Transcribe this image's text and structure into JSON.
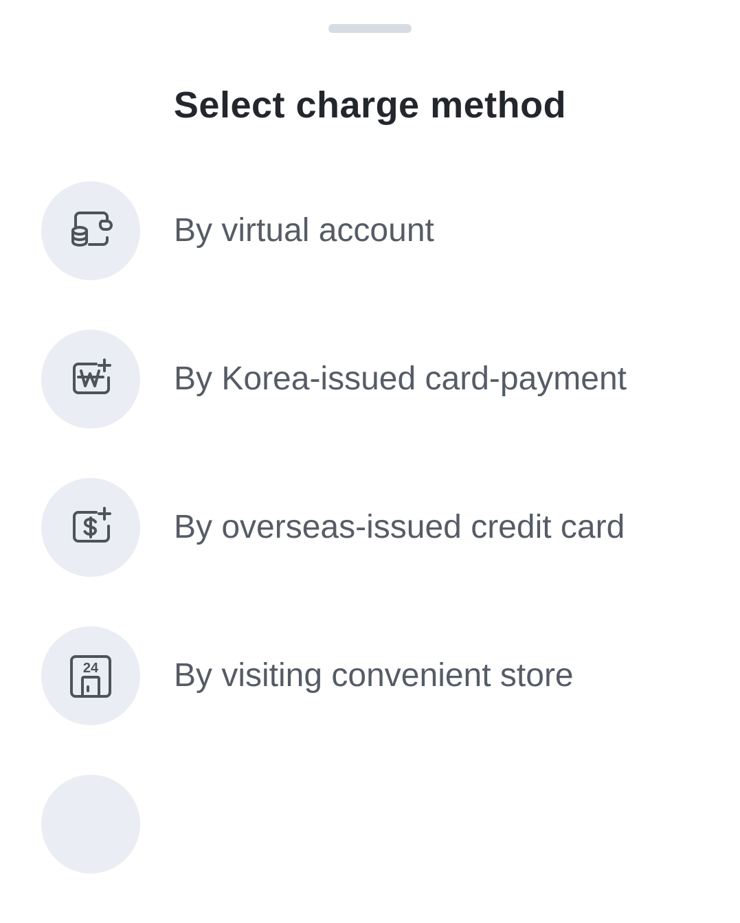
{
  "sheet": {
    "title": "Select charge method"
  },
  "options": [
    {
      "label": "By virtual account",
      "icon": "wallet-coins-icon"
    },
    {
      "label": "By Korea-issued card-payment",
      "icon": "won-card-plus-icon"
    },
    {
      "label": "By overseas-issued credit card",
      "icon": "dollar-card-plus-icon"
    },
    {
      "label": "By visiting convenient store",
      "icon": "store-24-icon",
      "icon_text": "24"
    },
    {
      "label": "",
      "icon": "partial-option-icon"
    }
  ],
  "colors": {
    "title": "#23272d",
    "label": "#555c66",
    "icon_bg": "#eaedf3",
    "icon_stroke": "#4d535c",
    "grabber": "#d7dce3"
  }
}
